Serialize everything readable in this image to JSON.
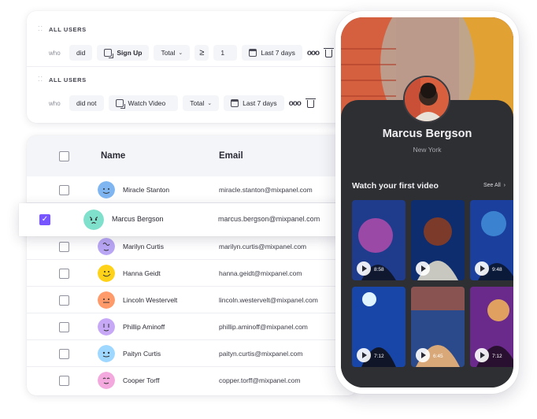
{
  "filters": [
    {
      "title": "ALL USERS",
      "who_label": "who",
      "condition": "did",
      "event": "Sign Up",
      "aggregation": "Total",
      "operator": "≥",
      "value": "1",
      "date_range": "Last 7 days"
    },
    {
      "title": "ALL USERS",
      "who_label": "who",
      "condition": "did not",
      "event": "Watch Video",
      "aggregation": "Total",
      "date_range": "Last 7 days"
    }
  ],
  "table": {
    "columns": {
      "name": "Name",
      "email": "Email"
    },
    "rows": [
      {
        "name": "Miracle Stanton",
        "email": "miracle.stanton@mixpanel.com",
        "avatar_color": "#7fb6f2"
      },
      {
        "name": "Marcus Bergson",
        "email": "marcus.bergson@mixpanel.com",
        "avatar_color": "#7fe0cc",
        "selected": true
      },
      {
        "name": "Marilyn Curtis",
        "email": "marilyn.curtis@mixpanel.com",
        "avatar_color": "#b9a6f5"
      },
      {
        "name": "Hanna Geidt",
        "email": "hanna.geidt@mixpanel.com",
        "avatar_color": "#ffd21a"
      },
      {
        "name": "Lincoln Westervelt",
        "email": "lincoln.westervelt@mixpanel.com",
        "avatar_color": "#ff9a6b"
      },
      {
        "name": "Phillip Aminoff",
        "email": "phillip.aminoff@mixpanel.com",
        "avatar_color": "#c6a8f7"
      },
      {
        "name": "Paityn Curtis",
        "email": "paityn.curtis@mixpanel.com",
        "avatar_color": "#9ed7ff"
      },
      {
        "name": "Cooper Torff",
        "email": "copper.torff@mixpanel.com",
        "avatar_color": "#f3a9dd"
      }
    ]
  },
  "phone": {
    "profile_name": "Marcus Bergson",
    "profile_city": "New York",
    "section_title": "Watch your first video",
    "see_all": "See All",
    "videos": [
      {
        "duration": "8:58"
      },
      {
        "duration": ""
      },
      {
        "duration": "9:48"
      },
      {
        "duration": "7:12"
      },
      {
        "duration": "6:45"
      },
      {
        "duration": "7:12"
      }
    ]
  },
  "colors": {
    "accent": "#7856ff",
    "phone_panel": "#2e2f33"
  }
}
